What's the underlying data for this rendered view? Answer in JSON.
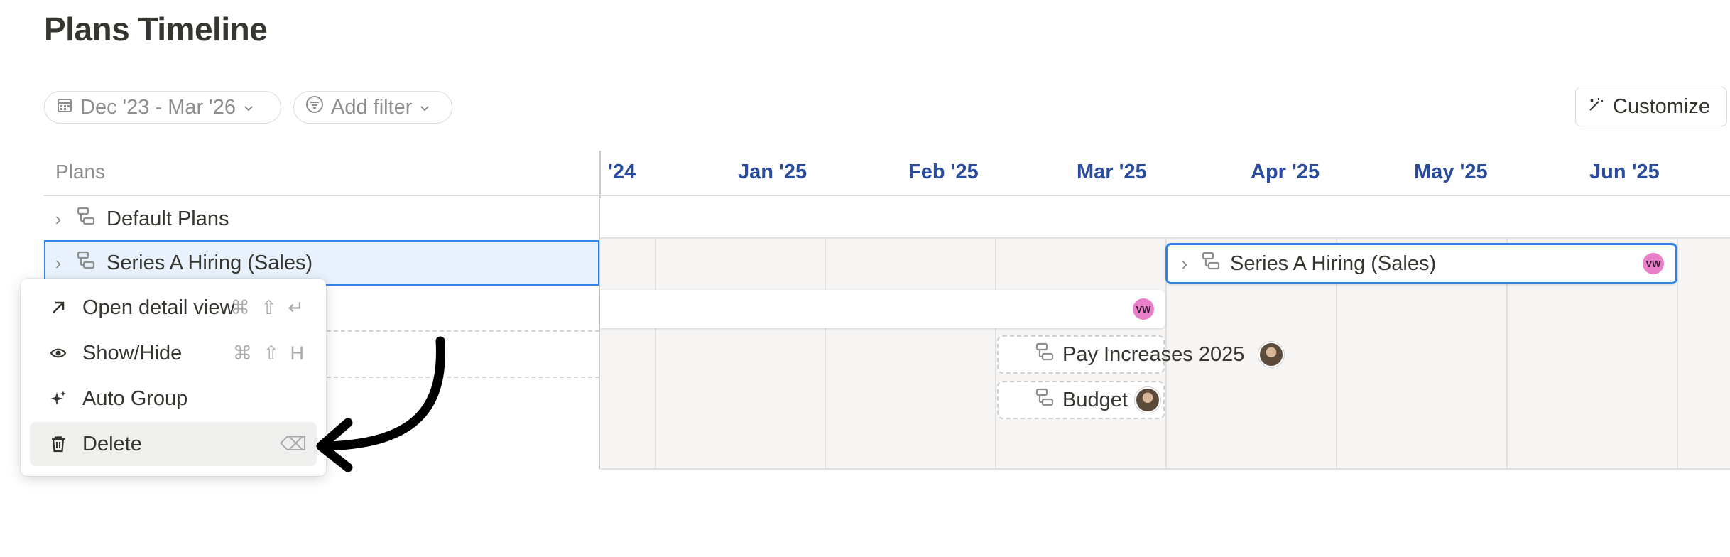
{
  "page_title": "Plans Timeline",
  "toolbar": {
    "date_range": "Dec '23 - Mar '26",
    "add_filter": "Add filter",
    "customize": "Customize"
  },
  "table": {
    "column_header": "Plans",
    "rows": [
      {
        "label": "Default Plans"
      },
      {
        "label": "Series A Hiring (Sales)"
      }
    ]
  },
  "timeline": {
    "months": [
      "'24",
      "Jan '25",
      "Feb '25",
      "Mar '25",
      "Apr '25",
      "May '25",
      "Jun '25"
    ],
    "bars": [
      {
        "label": "Series A Hiring (Sales)",
        "avatar": "VW"
      },
      {
        "label": "",
        "avatar": "VW"
      },
      {
        "label": "Pay Increases 2025",
        "avatar": "photo"
      },
      {
        "label": "Budget",
        "avatar": "photo"
      }
    ]
  },
  "context_menu": {
    "items": [
      {
        "label": "Open detail view",
        "shortcut": "⌘ ⇧ ↵",
        "icon": "arrow-up-right-icon"
      },
      {
        "label": "Show/Hide",
        "shortcut": "⌘ ⇧ H",
        "icon": "eye-icon"
      },
      {
        "label": "Auto Group",
        "shortcut": "",
        "icon": "sparkle-icon"
      },
      {
        "label": "Delete",
        "shortcut": "⌫",
        "icon": "trash-icon"
      }
    ]
  },
  "colors": {
    "accent": "#2e84e6",
    "month_text": "#2b4c9a",
    "avatar_pink": "#e97fc8"
  }
}
